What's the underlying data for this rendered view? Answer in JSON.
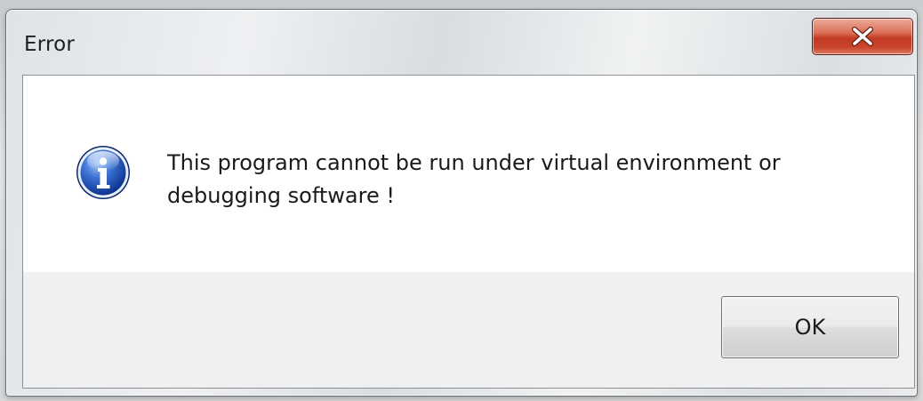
{
  "dialog": {
    "title": "Error",
    "close_button": {
      "icon": "close-icon",
      "color": "#c8452c"
    },
    "icon": "information-icon",
    "message_lines": [
      "This program cannot be run under virtual environment or",
      "debugging software !"
    ],
    "ok_label": "OK"
  }
}
